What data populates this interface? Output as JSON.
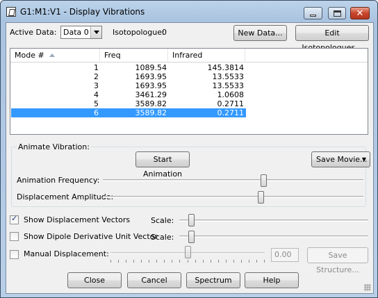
{
  "window": {
    "title": "G1:M1:V1 - Display Vibrations"
  },
  "active_data": {
    "label": "Active Data:",
    "value": "Data 0"
  },
  "isotopologue": {
    "label": "Isotopologue:",
    "value": "0"
  },
  "buttons": {
    "new_data": "New Data...",
    "edit_iso": "Edit Isotopologues...",
    "start_animation": "Start Animation",
    "save_movie": "Save Movie...",
    "save_structure": "Save Structure...",
    "close": "Close",
    "cancel": "Cancel",
    "spectrum": "Spectrum",
    "help": "Help"
  },
  "table": {
    "columns": [
      "Mode #",
      "Freq",
      "Infrared"
    ],
    "rows": [
      {
        "mode": "1",
        "freq": "1089.54",
        "ir": "145.3814"
      },
      {
        "mode": "2",
        "freq": "1693.95",
        "ir": "13.5533"
      },
      {
        "mode": "3",
        "freq": "1693.95",
        "ir": "13.5533"
      },
      {
        "mode": "4",
        "freq": "3461.29",
        "ir": "1.0608"
      },
      {
        "mode": "5",
        "freq": "3589.82",
        "ir": "0.2711"
      },
      {
        "mode": "6",
        "freq": "3589.82",
        "ir": "0.2711"
      }
    ],
    "selected_row": "6"
  },
  "animate": {
    "group_label": "Animate Vibration:",
    "freq_label": "Animation Frequency:",
    "amp_label": "Displacement Amplitude:",
    "freq_level": 0.62,
    "amp_level": 0.61
  },
  "options": {
    "show_vectors": {
      "label": "Show Displacement Vectors",
      "checked": true,
      "scale_label": "Scale:",
      "scale_level": 0.05
    },
    "show_dipole": {
      "label": "Show Dipole Derivative Unit Vector",
      "checked": false,
      "scale_label": "Scale:",
      "scale_level": 0.05
    },
    "manual": {
      "label": "Manual Displacement:",
      "checked": false,
      "value": "0.00",
      "level": 0.5
    }
  },
  "colors": {
    "selection": "#3399ff",
    "close_button": "#c8452b"
  },
  "icons": [
    "app-icon",
    "minimize-icon",
    "maximize-icon",
    "close-icon",
    "sort-ascending-icon",
    "dropdown-arrow-icon",
    "checkmark-icon",
    "resize-grip-icon"
  ]
}
